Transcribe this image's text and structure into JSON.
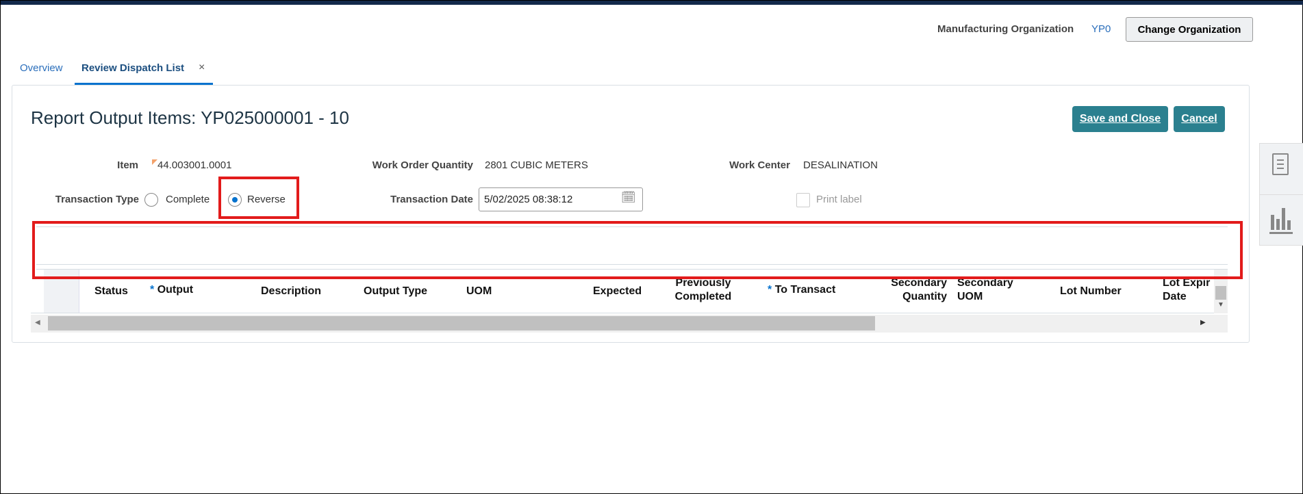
{
  "header": {
    "org_label": "Manufacturing Organization",
    "org_value": "YP0",
    "change_org": "Change Organization"
  },
  "tabs": [
    {
      "label": "Overview"
    },
    {
      "label": "Review Dispatch List",
      "close": "×"
    }
  ],
  "page": {
    "title": "Report Output Items: YP025000001 - 10",
    "save_close": "Save and Close",
    "cancel": "Cancel"
  },
  "form": {
    "item_label": "Item",
    "item_value": "44.003001.0001",
    "woq_label": "Work Order Quantity",
    "woq_value": "2801 CUBIC METERS",
    "wc_label": "Work Center",
    "wc_value": "DESALINATION",
    "tt_label": "Transaction Type",
    "tt_complete": "Complete",
    "tt_reverse": "Reverse",
    "tt_selected": "Reverse",
    "td_label": "Transaction Date",
    "td_value": "5/02/2025 08:38:12",
    "print_label": "Print label",
    "print_checked": false
  },
  "table": {
    "required_mark": "*",
    "columns": [
      "Status",
      "Output",
      "Description",
      "Output Type",
      "UOM",
      "Expected",
      "Previously",
      "Completed",
      "To Transact",
      "Secondary",
      "Quantity",
      "Secondary",
      "UOM",
      "Lot Number",
      "Lot Expir",
      "Date"
    ]
  },
  "colors": {
    "accent": "#0572ce",
    "button": "#2b808f",
    "highlight": "#e21b1b"
  }
}
